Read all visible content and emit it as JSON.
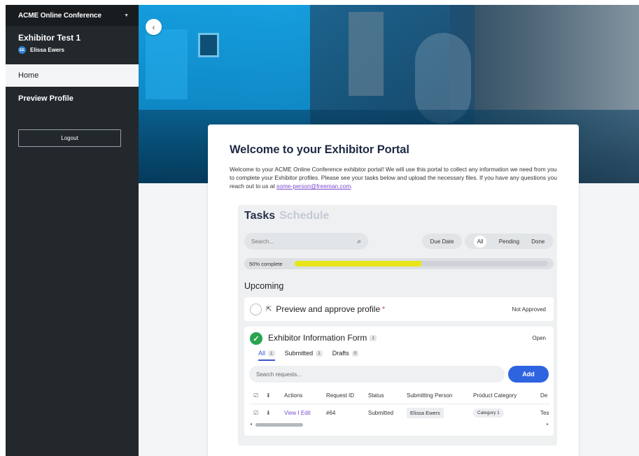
{
  "sidebar": {
    "org_name": "ACME Online Conference",
    "exhibitor_name": "Exhibitor Test 1",
    "user_initials": "EE",
    "user_name": "Elissa Ewers",
    "nav": [
      {
        "label": "Home"
      },
      {
        "label": "Preview Profile"
      }
    ],
    "logout_label": "Logout"
  },
  "card": {
    "title": "Welcome to your Exhibitor Portal",
    "intro_text": "Welcome to your ACME Online Conference exhibitor portal! We will use this portal to collect any information we need from you to complete your Exhibitor profiles. Please see your tasks below and upload the necessary files. If you have any questions you reach out to us at ",
    "intro_email": "some-person@freeman.com",
    "intro_end": "."
  },
  "tasks": {
    "tab_tasks": "Tasks",
    "tab_schedule": "Schedule",
    "search_placeholder": "Search...",
    "due_date_label": "Due Date",
    "filters": [
      "All",
      "Pending",
      "Done"
    ],
    "progress_label": "50% complete",
    "progress_fraction": 0.5,
    "upcoming_label": "Upcoming",
    "task1": {
      "title": "Preview and approve profile",
      "required_mark": "*",
      "status": "Not Approved"
    },
    "task2": {
      "title": "Exhibitor Information Form",
      "count": "1",
      "status": "Open",
      "subtabs": [
        {
          "label": "All",
          "count": "1"
        },
        {
          "label": "Submitted",
          "count": "1"
        },
        {
          "label": "Drafts",
          "count": "0"
        }
      ],
      "search_placeholder": "Search requests...",
      "add_label": "Add",
      "columns": [
        "Actions",
        "Request ID",
        "Status",
        "Submitting Person",
        "Product Category",
        "De"
      ],
      "row": {
        "actions": "View I Edit",
        "request_id": "#64",
        "status": "Submitted",
        "person": "Elissa Ewers",
        "category": "Category 1",
        "desc": "Tes"
      }
    }
  },
  "colors": {
    "sidebar_bg": "#23282c",
    "accent_blue": "#2f64e0",
    "progress_fill": "#e8e619",
    "success_green": "#2aa44f",
    "link_purple": "#7b4bd1"
  }
}
